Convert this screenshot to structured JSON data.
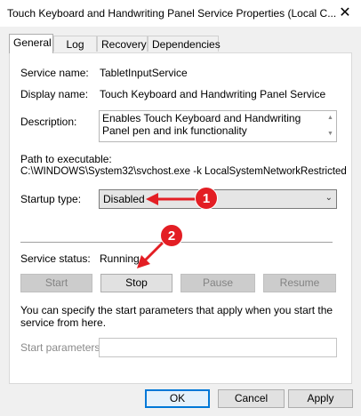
{
  "window": {
    "title": "Touch Keyboard and Handwriting Panel Service Properties (Local C..."
  },
  "tabs": [
    {
      "label": "General"
    },
    {
      "label": "Log On"
    },
    {
      "label": "Recovery"
    },
    {
      "label": "Dependencies"
    }
  ],
  "general": {
    "service_name_label": "Service name:",
    "service_name": "TabletInputService",
    "display_name_label": "Display name:",
    "display_name": "Touch Keyboard and Handwriting Panel Service",
    "description_label": "Description:",
    "description": "Enables Touch Keyboard and Handwriting Panel pen and ink functionality",
    "path_label": "Path to executable:",
    "path": "C:\\WINDOWS\\System32\\svchost.exe -k LocalSystemNetworkRestricted",
    "startup_type_label": "Startup type:",
    "startup_type": "Disabled",
    "service_status_label": "Service status:",
    "service_status": "Running",
    "buttons": {
      "start": "Start",
      "stop": "Stop",
      "pause": "Pause",
      "resume": "Resume"
    },
    "hint": "You can specify the start parameters that apply when you start the service from here.",
    "start_params_label": "Start parameters:",
    "start_params_value": ""
  },
  "footer": {
    "ok": "OK",
    "cancel": "Cancel",
    "apply": "Apply"
  },
  "annotations": {
    "marker1": "1",
    "marker2": "2",
    "color": "#e31e24"
  },
  "colors": {
    "accent": "#0078d7"
  }
}
